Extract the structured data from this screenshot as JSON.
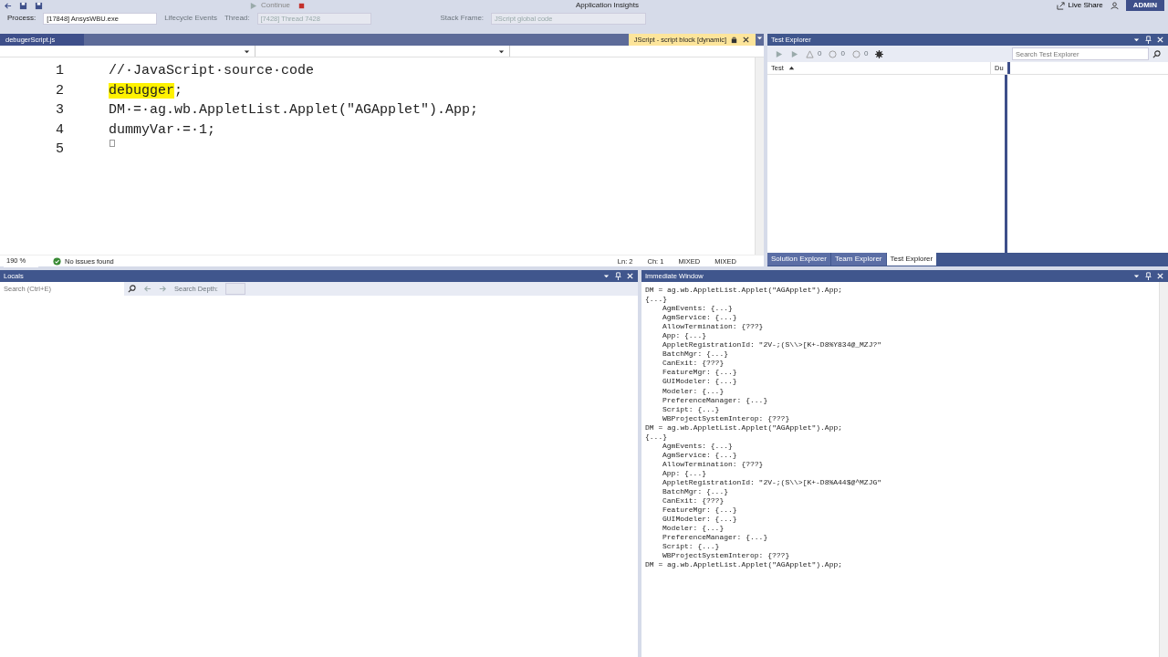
{
  "toolbar": {
    "continue_button": "Continue",
    "insights": "Application Insights",
    "live_share": "Live Share",
    "user": "ADMIN"
  },
  "debug_location": {
    "process_label": "Process:",
    "process": "[17848] AnsysWBU.exe",
    "lifecycle": "Lifecycle Events",
    "thread_label": "Thread:",
    "thread": "[7428] Thread 7428",
    "stack_label": "Stack Frame:",
    "stack_frame": "JScript global code"
  },
  "document_tabs": [
    {
      "label": "debugerScript.js",
      "selected": false
    },
    {
      "label": "JScript - script block [dynamic]",
      "selected": true
    }
  ],
  "editor": {
    "lines": [
      {
        "number": "1",
        "kind": "code",
        "segments": [
          {
            "text": "//·JavaScript·source·code",
            "highlighted": false
          }
        ]
      },
      {
        "number": "2",
        "kind": "code",
        "segments": [
          {
            "text": "debugger",
            "highlighted": true
          },
          {
            "text": ";",
            "highlighted": false
          }
        ]
      },
      {
        "number": "3",
        "kind": "code",
        "segments": [
          {
            "text": "DM·=·ag.wb.AppletList.Applet(\"AGApplet\").App;",
            "highlighted": false
          }
        ]
      },
      {
        "number": "4",
        "kind": "code",
        "segments": [
          {
            "text": "dummyVar·=·1;",
            "highlighted": false
          }
        ]
      },
      {
        "number": "5",
        "kind": "blank"
      }
    ],
    "zoom": "190 %",
    "issues": "No issues found",
    "position": [
      "Ln: 2",
      "Ch: 1",
      "MIXED",
      "MIXED"
    ]
  },
  "test_explorer": {
    "title": "Test Explorer",
    "counts": [
      "0",
      "0",
      "0"
    ],
    "search_placeholder": "Search Test Explorer",
    "columns": [
      "Test",
      "Du"
    ]
  },
  "explorer_tabs": [
    {
      "label": "Solution Explorer",
      "selected": false
    },
    {
      "label": "Team Explorer",
      "selected": false
    },
    {
      "label": "Test Explorer",
      "selected": true
    }
  ],
  "locals": {
    "title": "Locals",
    "search_placeholder": "Search (Ctrl+E)",
    "depth_label": "Search Depth:"
  },
  "immediate": {
    "title": "Immediate Window",
    "entries": [
      {
        "text": "DM = ag.wb.AppletList.Applet(\"AGApplet\").App;"
      },
      {
        "text": "{...}",
        "children": [
          {
            "text": "AgmEvents: {...}"
          },
          {
            "text": "AgmService: {...}"
          },
          {
            "text": "AllowTermination: {???}"
          },
          {
            "text": "App: {...}"
          },
          {
            "text": "AppletRegistrationId: \"2V-;(S\\\\>[K+-D8%Y834@_MZJ?\""
          },
          {
            "text": "BatchMgr: {...}"
          },
          {
            "text": "CanExit: {???}"
          },
          {
            "text": "FeatureMgr: {...}"
          },
          {
            "text": "GUIModeler: {...}"
          },
          {
            "text": "Modeler: {...}"
          },
          {
            "text": "PreferenceManager: {...}"
          },
          {
            "text": "Script: {...}"
          },
          {
            "text": "WBProjectSystemInterop: {???}"
          }
        ]
      },
      {
        "text": "DM = ag.wb.AppletList.Applet(\"AGApplet\").App;"
      },
      {
        "text": "{...}",
        "children": [
          {
            "text": "AgmEvents: {...}"
          },
          {
            "text": "AgmService: {...}"
          },
          {
            "text": "AllowTermination: {???}"
          },
          {
            "text": "App: {...}"
          },
          {
            "text": "AppletRegistrationId: \"2V-;(S\\\\>[K+-D8%A44$@^MZJG\""
          },
          {
            "text": "BatchMgr: {...}"
          },
          {
            "text": "CanExit: {???}"
          },
          {
            "text": "FeatureMgr: {...}"
          },
          {
            "text": "GUIModeler: {...}"
          },
          {
            "text": "Modeler: {...}"
          },
          {
            "text": "PreferenceManager: {...}"
          },
          {
            "text": "Script: {...}"
          },
          {
            "text": "WBProjectSystemInterop: {???}"
          }
        ]
      },
      {
        "text": "DM = ag.wb.AppletList.Applet(\"AGApplet\").App;"
      }
    ]
  }
}
